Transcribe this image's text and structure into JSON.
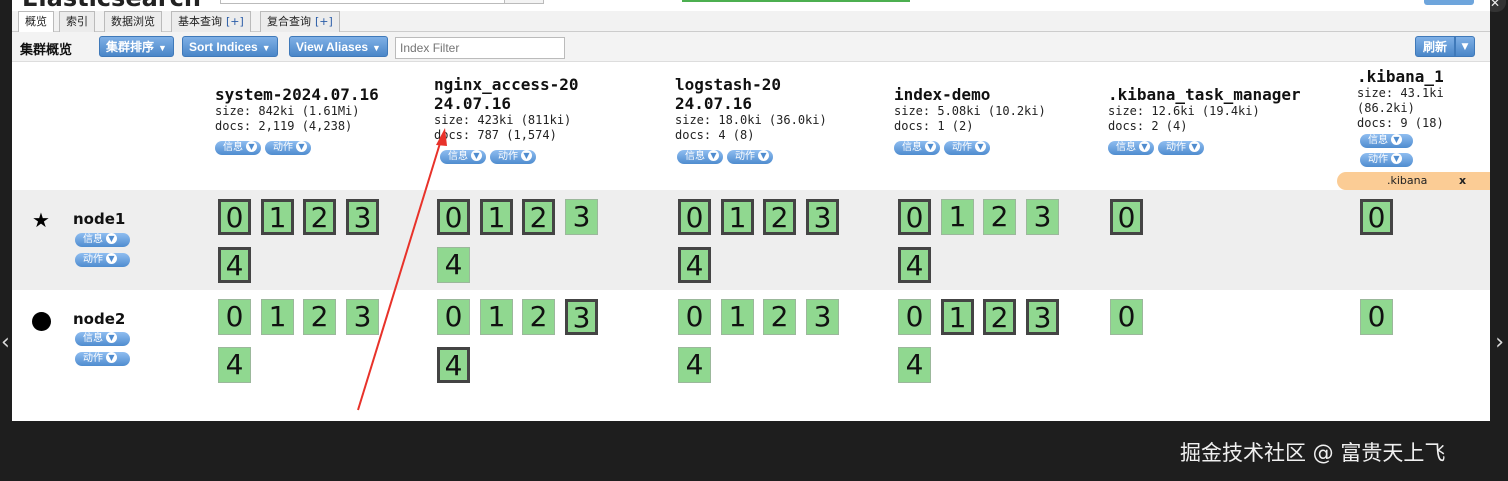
{
  "app": {
    "brand": "Elasticsearch"
  },
  "tabs": [
    {
      "label": "概览",
      "plus": ""
    },
    {
      "label": "索引",
      "plus": ""
    },
    {
      "label": "数据浏览",
      "plus": ""
    },
    {
      "label": "基本查询",
      "plus": "[+]"
    },
    {
      "label": "复合查询",
      "plus": "[+]"
    }
  ],
  "toolbar": {
    "title": "集群概览",
    "cluster_sort": "集群排序",
    "sort_indices": "Sort Indices",
    "view_aliases": "View Aliases",
    "index_filter_placeholder": "Index Filter",
    "refresh": "刷新"
  },
  "pill_labels": {
    "info": "信息",
    "action": "动作"
  },
  "indices": [
    {
      "name": "system-2024.07.16",
      "size": "size: 842ki (1.61Mi)",
      "docs": "docs: 2,119 (4,238)"
    },
    {
      "name": "nginx_access-2024.07.16",
      "size": "size: 423ki (811ki)",
      "docs": "docs: 787 (1,574)"
    },
    {
      "name": "logstash-2024.07.16",
      "size": "size: 18.0ki (36.0ki)",
      "docs": "docs: 4 (8)"
    },
    {
      "name": "index-demo",
      "size": "size: 5.08ki (10.2ki)",
      "docs": "docs: 1 (2)"
    },
    {
      "name": ".kibana_task_manager",
      "size": "size: 12.6ki (19.4ki)",
      "docs": "docs: 2 (4)"
    },
    {
      "name": ".kibana_1",
      "size": "size: 43.1ki (86.2ki)",
      "docs": "docs: 9 (18)"
    }
  ],
  "alias": {
    "name": ".kibana",
    "close": "x"
  },
  "nodes": [
    {
      "name": "node1",
      "master": true
    },
    {
      "name": "node2",
      "master": false
    }
  ],
  "shards": {
    "multi": [
      "0",
      "1",
      "2",
      "3",
      "4"
    ],
    "single": [
      "0"
    ]
  },
  "watermark": "掘金技术社区 @ 富贵天上飞",
  "colors": {
    "shard_green": "#90d890",
    "button_blue": "#4a86c8",
    "alias_orange": "#fbcc95",
    "annotation_arrow": "#e8322a"
  }
}
